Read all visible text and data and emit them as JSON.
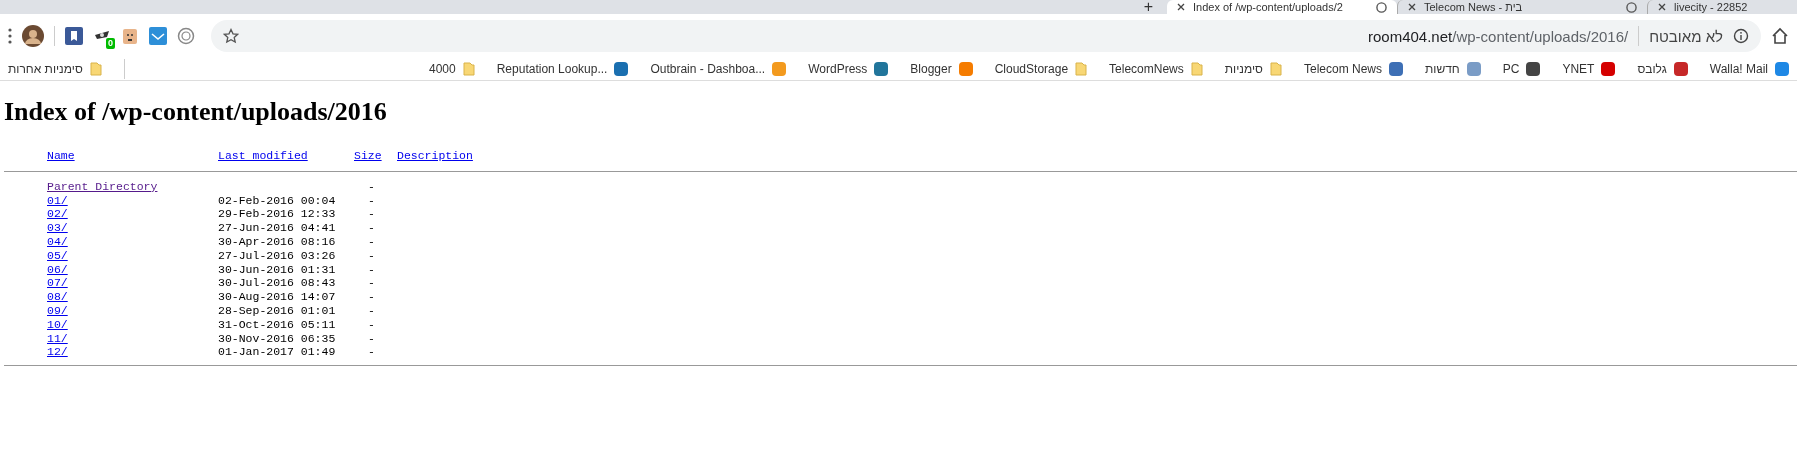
{
  "tabs": [
    {
      "title": "Index of /wp-content/uploads/2",
      "selected": true
    },
    {
      "title": "Telecom News - בית",
      "selected": false
    },
    {
      "title": "livecity - 22852",
      "selected": false
    }
  ],
  "new_tab": "+",
  "toolbar": {
    "extension_badge": "0",
    "security_label": "לא מאובטח",
    "url_host": "room404.net",
    "url_path": "/wp-content/uploads/2016/"
  },
  "other_bookmarks": "סימניות אחרות",
  "bookmarks": [
    {
      "label": "4000",
      "kind": "folder"
    },
    {
      "label": "Reputation Lookup...",
      "kind": "site",
      "color": "#1a6fb0"
    },
    {
      "label": "Outbrain - Dashboa...",
      "kind": "site",
      "color": "#f39a1e"
    },
    {
      "label": "WordPress",
      "kind": "site",
      "color": "#21759b"
    },
    {
      "label": "Blogger",
      "kind": "site",
      "color": "#f57c00"
    },
    {
      "label": "CloudStorage",
      "kind": "folder"
    },
    {
      "label": "TelecomNews",
      "kind": "folder"
    },
    {
      "label": "סימניות",
      "kind": "folder"
    },
    {
      "label": "Telecom News",
      "kind": "site",
      "color": "#3d6fb5"
    },
    {
      "label": "חדשות",
      "kind": "site",
      "color": "#7a9cc6"
    },
    {
      "label": "PC",
      "kind": "site",
      "color": "#444444"
    },
    {
      "label": "YNET",
      "kind": "site",
      "color": "#d50000"
    },
    {
      "label": "גלובס",
      "kind": "site",
      "color": "#c62828"
    },
    {
      "label": "Walla! Mail",
      "kind": "site",
      "color": "#1e88e5"
    }
  ],
  "page": {
    "title": "Index of /wp-content/uploads/2016",
    "columns": [
      "Name",
      "Last modified",
      "Size",
      "Description"
    ],
    "rows": [
      {
        "name": "Parent Directory",
        "modified": "",
        "size": "-",
        "visited": true
      },
      {
        "name": "01/",
        "modified": "02-Feb-2016 00:04",
        "size": "-",
        "visited": false
      },
      {
        "name": "02/",
        "modified": "29-Feb-2016 12:33",
        "size": "-",
        "visited": false
      },
      {
        "name": "03/",
        "modified": "27-Jun-2016 04:41",
        "size": "-",
        "visited": false
      },
      {
        "name": "04/",
        "modified": "30-Apr-2016 08:16",
        "size": "-",
        "visited": false
      },
      {
        "name": "05/",
        "modified": "27-Jul-2016 03:26",
        "size": "-",
        "visited": false
      },
      {
        "name": "06/",
        "modified": "30-Jun-2016 01:31",
        "size": "-",
        "visited": false
      },
      {
        "name": "07/",
        "modified": "30-Jul-2016 08:43",
        "size": "-",
        "visited": false
      },
      {
        "name": "08/",
        "modified": "30-Aug-2016 14:07",
        "size": "-",
        "visited": false
      },
      {
        "name": "09/",
        "modified": "28-Sep-2016 01:01",
        "size": "-",
        "visited": false
      },
      {
        "name": "10/",
        "modified": "31-Oct-2016 05:11",
        "size": "-",
        "visited": false
      },
      {
        "name": "11/",
        "modified": "30-Nov-2016 06:35",
        "size": "-",
        "visited": false
      },
      {
        "name": "12/",
        "modified": "01-Jan-2017 01:49",
        "size": "-",
        "visited": false
      }
    ]
  }
}
